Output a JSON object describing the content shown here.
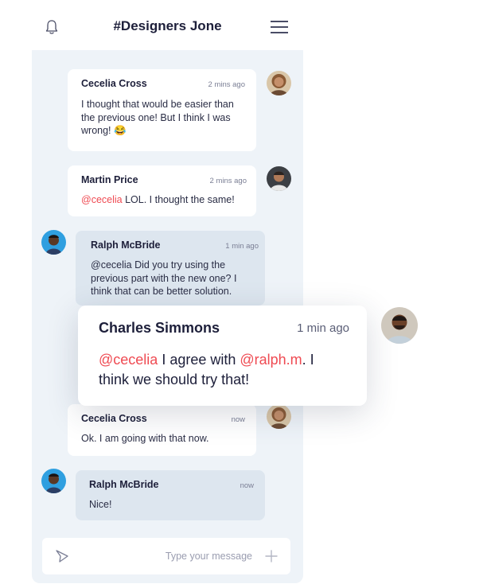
{
  "header": {
    "title": "#Designers Jone"
  },
  "messages": [
    {
      "name": "Cecelia Cross",
      "time": "2 mins ago",
      "text": "I thought that would be easier than the previous one! But I think I was wrong! 😂"
    },
    {
      "name": "Martin Price",
      "time": "2 mins ago",
      "mention": "@cecelia",
      "text": " LOL. I thought the same!"
    },
    {
      "name": "Ralph McBride",
      "time": "1 min ago",
      "text": "@cecelia Did you try using the previous part with the new one? I think that can be better solution."
    },
    {
      "name": "Cecelia Cross",
      "time": "now",
      "text": "Ok. I am going with that now."
    },
    {
      "name": "Ralph McBride",
      "time": "now",
      "text": "Nice!"
    }
  ],
  "highlight": {
    "name": "Charles Simmons",
    "time": "1 min ago",
    "mention1": "@cecelia",
    "mid": " I agree with ",
    "mention2": "@ralph.m",
    "end": ". I think we should try that!"
  },
  "composer": {
    "placeholder": "Type your message"
  },
  "colors": {
    "accent": "#ef4a52",
    "panel": "#eef3f8",
    "bubble_blue": "#dde6ef"
  },
  "icons": [
    "bell-icon",
    "menu-icon",
    "send-icon",
    "plus-icon"
  ]
}
